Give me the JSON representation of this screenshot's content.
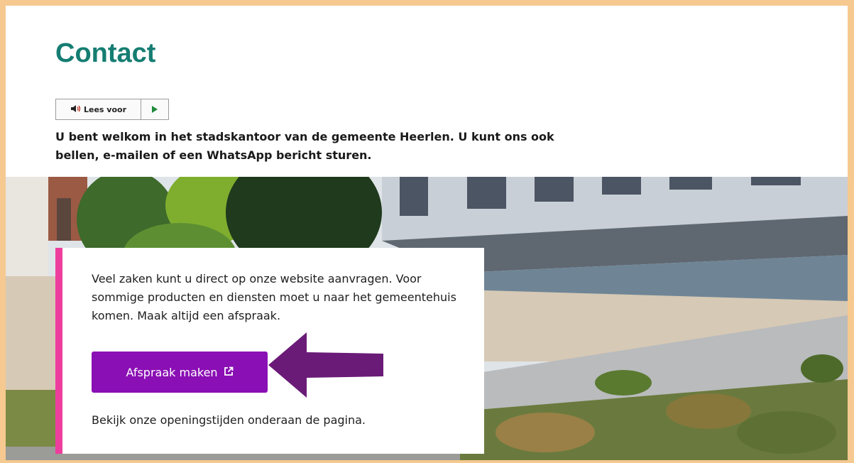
{
  "page": {
    "title": "Contact",
    "read_aloud": {
      "label": "Lees voor"
    },
    "intro": "U bent welkom in het stadskantoor van de gemeente Heerlen. U kunt ons ook bellen, e-mailen of een WhatsApp bericht sturen."
  },
  "card": {
    "text": "Veel zaken kunt u direct op onze website aanvragen. Voor sommige producten en diensten moet u naar het gemeentehuis komen. Maak altijd een afspraak.",
    "button_label": "Afspraak maken",
    "footer": "Bekijk onze openingstijden onderaan de pagina."
  },
  "colors": {
    "title": "#157d72",
    "button": "#8a0fb4",
    "card_accent": "#ed3e9e",
    "annotation_arrow": "#6a1b78",
    "frame": "#f5c990"
  },
  "icons": [
    "speaker-icon",
    "play-icon",
    "external-link-icon",
    "pointer-arrow-icon"
  ]
}
